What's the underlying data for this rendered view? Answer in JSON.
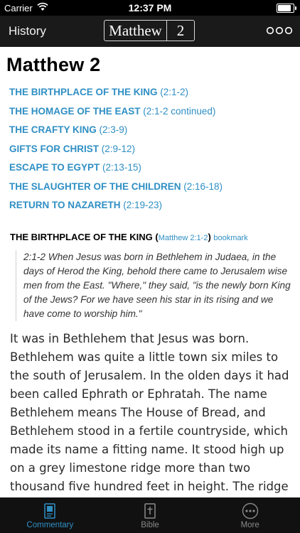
{
  "status_bar": {
    "carrier": "Carrier",
    "time": "12:37 PM",
    "battery_level": 0.95
  },
  "nav": {
    "back_label": "History",
    "book": "Matthew",
    "chapter": "2"
  },
  "page_title": "Matthew 2",
  "toc": [
    {
      "title": "THE BIRTHPLACE OF THE KING",
      "ref": "(2:1-2)"
    },
    {
      "title": "THE HOMAGE OF THE EAST",
      "ref": "(2:1-2 continued)"
    },
    {
      "title": "THE CRAFTY KING",
      "ref": "(2:3-9)"
    },
    {
      "title": "GIFTS FOR CHRIST",
      "ref": "(2:9-12)"
    },
    {
      "title": "ESCAPE TO EGYPT",
      "ref": "(2:13-15)"
    },
    {
      "title": "THE SLAUGHTER OF THE CHILDREN",
      "ref": "(2:16-18)"
    },
    {
      "title": "RETURN TO NAZARETH",
      "ref": "(2:19-23)"
    }
  ],
  "section": {
    "title": "THE BIRTHPLACE OF THE KING",
    "open_paren": "(",
    "ref_link": "Matthew 2:1-2",
    "close_paren": ")",
    "bookmark_label": "bookmark",
    "scripture": "2:1-2 When Jesus was born in Bethlehem in Judaea, in the days of Herod the King, behold there came to Jerusalem wise men from the East. \"Where,\" they said, \"is the newly born King of the Jews? For we have seen his star in its rising and we have come to worship him.\"",
    "body": "It was in Bethlehem that Jesus was born. Bethlehem was quite a little town six miles to the south of Jerusalem. In the olden days it had been called Ephrath or Ephratah. The name Bethlehem means The House of Bread, and Bethlehem stood in a fertile countryside, which made its name a fitting name. It stood high up on a grey limestone ridge more than two thousand five hundred feet in height. The ridge"
  },
  "tabs": [
    {
      "label": "Commentary",
      "icon": "commentary-book-icon",
      "active": true
    },
    {
      "label": "Bible",
      "icon": "bible-cross-icon",
      "active": false
    },
    {
      "label": "More",
      "icon": "more-dots-icon",
      "active": false
    }
  ],
  "colors": {
    "accent": "#2f8fc4",
    "nav_bg": "#1a1a1a",
    "tab_bg": "#111111"
  }
}
